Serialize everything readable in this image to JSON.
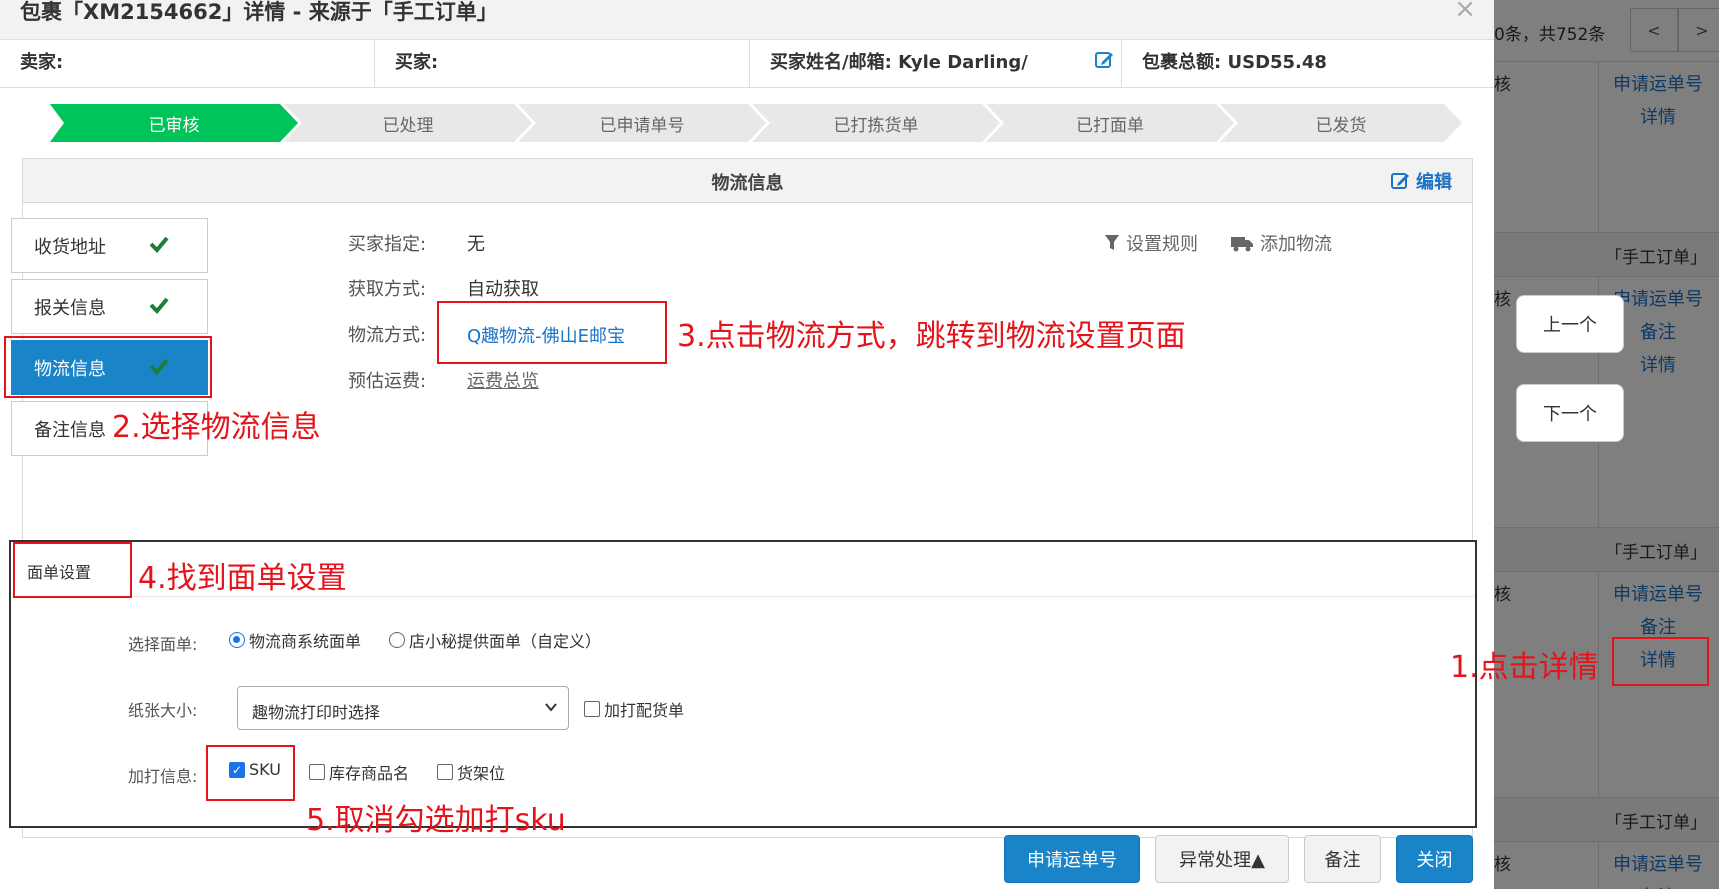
{
  "background": {
    "pager_count": "0条，共752条",
    "prev": "<",
    "next": ">",
    "rows": [
      {
        "header": "",
        "left": "核",
        "links": [
          "申请运单号",
          "详情"
        ]
      },
      {
        "header": "「手工订单」",
        "left": "核",
        "links": [
          "申请运单号",
          "备注",
          "详情"
        ]
      },
      {
        "header": "「手工订单」",
        "left": "核",
        "links": [
          "申请运单号",
          "备注",
          "详情"
        ]
      },
      {
        "header": "「手工订单」",
        "left": "核",
        "links": [
          "申请运单号",
          "备注"
        ]
      }
    ],
    "nav_prev": "上一个",
    "nav_next": "下一个"
  },
  "modal": {
    "title": "包裹「XM2154662」详情 - 来源于「手工订单」",
    "close": "×",
    "info": {
      "seller_label": "卖家:",
      "buyer_label": "买家:",
      "buyer_name_label": "买家姓名/邮箱:",
      "buyer_name_value": "Kyle Darling/",
      "total_label": "包裹总额:",
      "total_value": "USD55.48"
    },
    "steps": [
      "已审核",
      "已处理",
      "已申请单号",
      "已打拣货单",
      "已打面单",
      "已发货"
    ],
    "panel_title": "物流信息",
    "panel_edit": "编辑",
    "side_tabs": [
      "收货地址",
      "报关信息",
      "物流信息",
      "备注信息"
    ],
    "fields": {
      "buyer_specified_label": "买家指定:",
      "buyer_specified_value": "无",
      "acquire_label": "获取方式:",
      "acquire_value": "自动获取",
      "method_label": "物流方式:",
      "method_value": "Q趣物流-佛山E邮宝",
      "fee_label": "预估运费:",
      "fee_value": "运费总览"
    },
    "tools": {
      "rules": "设置规则",
      "add": "添加物流"
    },
    "label_settings": {
      "title": "面单设置",
      "select_label": "选择面单:",
      "radio_options": [
        "物流商系统面单",
        "店小秘提供面单（自定义）"
      ],
      "paper_label": "纸张大小:",
      "paper_value": "趣物流打印时选择",
      "extra_pick": "加打配货单",
      "extra_label": "加打信息:",
      "extra_options": [
        "SKU",
        "库存商品名",
        "货架位"
      ]
    },
    "buttons": {
      "apply": "申请运单号",
      "exception": "异常处理▲",
      "note": "备注",
      "close": "关闭"
    }
  },
  "annotations": {
    "step1": "1.点击详情",
    "step2": "2.选择物流信息",
    "step3": "3.点击物流方式，跳转到物流设置页面",
    "step4": "4.找到面单设置",
    "step5": "5.取消勾选加打sku"
  },
  "colors": {
    "accent": "#1a84c8",
    "step_active": "#00c45a",
    "annotation": "#e5141b"
  }
}
